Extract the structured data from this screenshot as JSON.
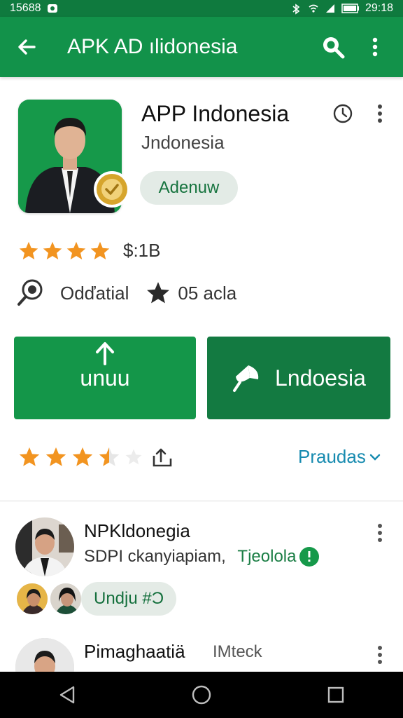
{
  "status_bar": {
    "left_text": "15688",
    "time": "29:18"
  },
  "app_bar": {
    "title": "APK AD ılidonesia"
  },
  "app": {
    "title": "APP Indonesia",
    "developer": "Jndonesia",
    "chip_label": "Adenuw",
    "rating_text": "$:1B",
    "rating_stars": 4.5,
    "meta_left": "Odďatial",
    "meta_right": "05 acla"
  },
  "buttons": {
    "install_label": "unuu",
    "second_label": "Lndoesia"
  },
  "rating_row": {
    "stars": 3.5,
    "link_label": "Praudas"
  },
  "reviews": [
    {
      "name": "ΝPKldonegia",
      "text": "SDPI ckanyiapiam,",
      "tag": "Tjeolola",
      "pill_label": "Undju #Ɔ"
    },
    {
      "name": "Pimaghaatiä",
      "tag": "IMteck"
    }
  ],
  "colors": {
    "primary": "#12924a",
    "primary_dark": "#0f7a3e",
    "link": "#178bb0",
    "star": "#f29420"
  }
}
